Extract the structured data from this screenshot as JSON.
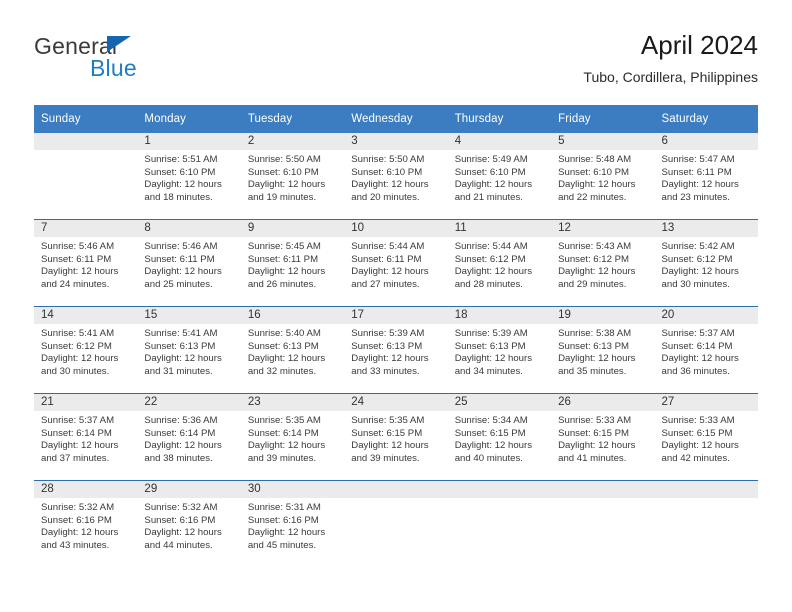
{
  "brand": {
    "name_part1": "General",
    "name_part2": "Blue",
    "triangle_icon": "triangle-icon",
    "color_dark": "#3b3b3b",
    "color_blue": "#1f7ec4"
  },
  "header": {
    "title": "April 2024",
    "subtitle": "Tubo, Cordillera, Philippines"
  },
  "theme": {
    "header_blue": "#3b7dc0",
    "row_divider_blue": "#2e6cab",
    "daynum_band": "#ebebeb",
    "text": "#3a3a3a"
  },
  "weekday_headers": [
    "Sunday",
    "Monday",
    "Tuesday",
    "Wednesday",
    "Thursday",
    "Friday",
    "Saturday"
  ],
  "weeks": [
    [
      {
        "day": "",
        "sunrise": "",
        "sunset": "",
        "daylight1": "",
        "daylight2": "",
        "empty": true
      },
      {
        "day": "1",
        "sunrise": "Sunrise: 5:51 AM",
        "sunset": "Sunset: 6:10 PM",
        "daylight1": "Daylight: 12 hours",
        "daylight2": "and 18 minutes."
      },
      {
        "day": "2",
        "sunrise": "Sunrise: 5:50 AM",
        "sunset": "Sunset: 6:10 PM",
        "daylight1": "Daylight: 12 hours",
        "daylight2": "and 19 minutes."
      },
      {
        "day": "3",
        "sunrise": "Sunrise: 5:50 AM",
        "sunset": "Sunset: 6:10 PM",
        "daylight1": "Daylight: 12 hours",
        "daylight2": "and 20 minutes."
      },
      {
        "day": "4",
        "sunrise": "Sunrise: 5:49 AM",
        "sunset": "Sunset: 6:10 PM",
        "daylight1": "Daylight: 12 hours",
        "daylight2": "and 21 minutes."
      },
      {
        "day": "5",
        "sunrise": "Sunrise: 5:48 AM",
        "sunset": "Sunset: 6:10 PM",
        "daylight1": "Daylight: 12 hours",
        "daylight2": "and 22 minutes."
      },
      {
        "day": "6",
        "sunrise": "Sunrise: 5:47 AM",
        "sunset": "Sunset: 6:11 PM",
        "daylight1": "Daylight: 12 hours",
        "daylight2": "and 23 minutes."
      }
    ],
    [
      {
        "day": "7",
        "sunrise": "Sunrise: 5:46 AM",
        "sunset": "Sunset: 6:11 PM",
        "daylight1": "Daylight: 12 hours",
        "daylight2": "and 24 minutes."
      },
      {
        "day": "8",
        "sunrise": "Sunrise: 5:46 AM",
        "sunset": "Sunset: 6:11 PM",
        "daylight1": "Daylight: 12 hours",
        "daylight2": "and 25 minutes."
      },
      {
        "day": "9",
        "sunrise": "Sunrise: 5:45 AM",
        "sunset": "Sunset: 6:11 PM",
        "daylight1": "Daylight: 12 hours",
        "daylight2": "and 26 minutes."
      },
      {
        "day": "10",
        "sunrise": "Sunrise: 5:44 AM",
        "sunset": "Sunset: 6:11 PM",
        "daylight1": "Daylight: 12 hours",
        "daylight2": "and 27 minutes."
      },
      {
        "day": "11",
        "sunrise": "Sunrise: 5:44 AM",
        "sunset": "Sunset: 6:12 PM",
        "daylight1": "Daylight: 12 hours",
        "daylight2": "and 28 minutes."
      },
      {
        "day": "12",
        "sunrise": "Sunrise: 5:43 AM",
        "sunset": "Sunset: 6:12 PM",
        "daylight1": "Daylight: 12 hours",
        "daylight2": "and 29 minutes."
      },
      {
        "day": "13",
        "sunrise": "Sunrise: 5:42 AM",
        "sunset": "Sunset: 6:12 PM",
        "daylight1": "Daylight: 12 hours",
        "daylight2": "and 30 minutes."
      }
    ],
    [
      {
        "day": "14",
        "sunrise": "Sunrise: 5:41 AM",
        "sunset": "Sunset: 6:12 PM",
        "daylight1": "Daylight: 12 hours",
        "daylight2": "and 30 minutes."
      },
      {
        "day": "15",
        "sunrise": "Sunrise: 5:41 AM",
        "sunset": "Sunset: 6:13 PM",
        "daylight1": "Daylight: 12 hours",
        "daylight2": "and 31 minutes."
      },
      {
        "day": "16",
        "sunrise": "Sunrise: 5:40 AM",
        "sunset": "Sunset: 6:13 PM",
        "daylight1": "Daylight: 12 hours",
        "daylight2": "and 32 minutes."
      },
      {
        "day": "17",
        "sunrise": "Sunrise: 5:39 AM",
        "sunset": "Sunset: 6:13 PM",
        "daylight1": "Daylight: 12 hours",
        "daylight2": "and 33 minutes."
      },
      {
        "day": "18",
        "sunrise": "Sunrise: 5:39 AM",
        "sunset": "Sunset: 6:13 PM",
        "daylight1": "Daylight: 12 hours",
        "daylight2": "and 34 minutes."
      },
      {
        "day": "19",
        "sunrise": "Sunrise: 5:38 AM",
        "sunset": "Sunset: 6:13 PM",
        "daylight1": "Daylight: 12 hours",
        "daylight2": "and 35 minutes."
      },
      {
        "day": "20",
        "sunrise": "Sunrise: 5:37 AM",
        "sunset": "Sunset: 6:14 PM",
        "daylight1": "Daylight: 12 hours",
        "daylight2": "and 36 minutes."
      }
    ],
    [
      {
        "day": "21",
        "sunrise": "Sunrise: 5:37 AM",
        "sunset": "Sunset: 6:14 PM",
        "daylight1": "Daylight: 12 hours",
        "daylight2": "and 37 minutes."
      },
      {
        "day": "22",
        "sunrise": "Sunrise: 5:36 AM",
        "sunset": "Sunset: 6:14 PM",
        "daylight1": "Daylight: 12 hours",
        "daylight2": "and 38 minutes."
      },
      {
        "day": "23",
        "sunrise": "Sunrise: 5:35 AM",
        "sunset": "Sunset: 6:14 PM",
        "daylight1": "Daylight: 12 hours",
        "daylight2": "and 39 minutes."
      },
      {
        "day": "24",
        "sunrise": "Sunrise: 5:35 AM",
        "sunset": "Sunset: 6:15 PM",
        "daylight1": "Daylight: 12 hours",
        "daylight2": "and 39 minutes."
      },
      {
        "day": "25",
        "sunrise": "Sunrise: 5:34 AM",
        "sunset": "Sunset: 6:15 PM",
        "daylight1": "Daylight: 12 hours",
        "daylight2": "and 40 minutes."
      },
      {
        "day": "26",
        "sunrise": "Sunrise: 5:33 AM",
        "sunset": "Sunset: 6:15 PM",
        "daylight1": "Daylight: 12 hours",
        "daylight2": "and 41 minutes."
      },
      {
        "day": "27",
        "sunrise": "Sunrise: 5:33 AM",
        "sunset": "Sunset: 6:15 PM",
        "daylight1": "Daylight: 12 hours",
        "daylight2": "and 42 minutes."
      }
    ],
    [
      {
        "day": "28",
        "sunrise": "Sunrise: 5:32 AM",
        "sunset": "Sunset: 6:16 PM",
        "daylight1": "Daylight: 12 hours",
        "daylight2": "and 43 minutes."
      },
      {
        "day": "29",
        "sunrise": "Sunrise: 5:32 AM",
        "sunset": "Sunset: 6:16 PM",
        "daylight1": "Daylight: 12 hours",
        "daylight2": "and 44 minutes."
      },
      {
        "day": "30",
        "sunrise": "Sunrise: 5:31 AM",
        "sunset": "Sunset: 6:16 PM",
        "daylight1": "Daylight: 12 hours",
        "daylight2": "and 45 minutes."
      },
      {
        "day": "",
        "sunrise": "",
        "sunset": "",
        "daylight1": "",
        "daylight2": "",
        "empty": true
      },
      {
        "day": "",
        "sunrise": "",
        "sunset": "",
        "daylight1": "",
        "daylight2": "",
        "empty": true
      },
      {
        "day": "",
        "sunrise": "",
        "sunset": "",
        "daylight1": "",
        "daylight2": "",
        "empty": true
      },
      {
        "day": "",
        "sunrise": "",
        "sunset": "",
        "daylight1": "",
        "daylight2": "",
        "empty": true
      }
    ]
  ]
}
